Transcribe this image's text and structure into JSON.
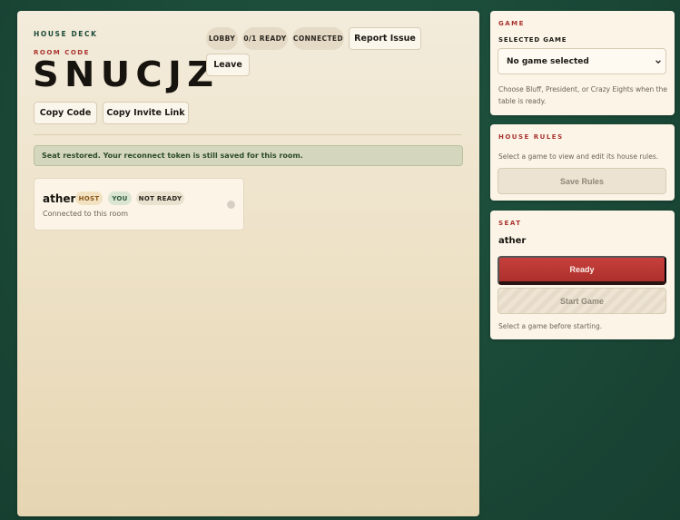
{
  "main": {
    "brand": "HOUSE DECK",
    "room_label": "ROOM CODE",
    "room_code": "SNUCJZ",
    "copy_code_label": "Copy Code",
    "copy_link_label": "Copy Invite Link",
    "status_pills": {
      "phase": "LOBBY",
      "ready_count": "0/1 READY",
      "connection": "CONNECTED"
    },
    "report_label": "Report Issue",
    "leave_label": "Leave",
    "notice": "Seat restored. Your reconnect token is still saved for this room.",
    "players": [
      {
        "name": "ather",
        "tags": {
          "host": "HOST",
          "you": "YOU",
          "ready": "NOT READY"
        },
        "subtitle": "Connected to this room",
        "status_color": "#d6d0c4"
      }
    ]
  },
  "sidebar": {
    "game": {
      "title": "GAME",
      "field_label": "SELECTED GAME",
      "selected_value": "No game selected",
      "help": "Choose Bluff, President, or Crazy Eights when the table is ready."
    },
    "rules": {
      "title": "HOUSE RULES",
      "help": "Select a game to view and edit its house rules.",
      "save_label": "Save Rules"
    },
    "seat": {
      "title": "SEAT",
      "name": "ather",
      "ready_label": "Ready",
      "start_label": "Start Game",
      "help": "Select a game before starting."
    }
  },
  "colors": {
    "background": "#1b4a38",
    "accent_red": "#a8322e",
    "brand_green": "#1d4a37",
    "ready_button": "#c6403c"
  }
}
